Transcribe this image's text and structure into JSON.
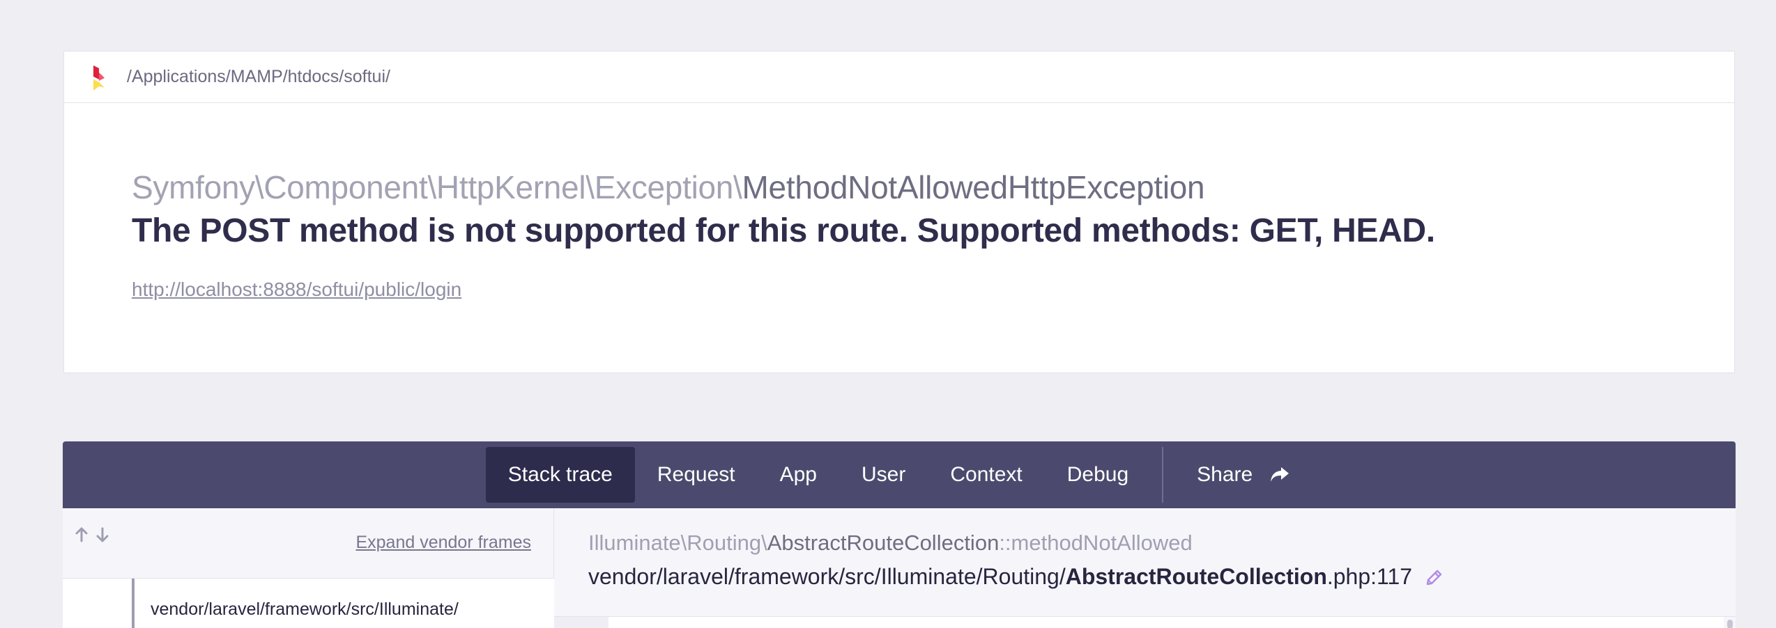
{
  "header": {
    "path": "/Applications/MAMP/htdocs/softui/"
  },
  "exception": {
    "namespace": "Symfony\\Component\\HttpKernel\\Exception\\",
    "class_name": "MethodNotAllowedHttpException",
    "message": "The POST method is not supported for this route. Supported methods: GET, HEAD.",
    "url": "http://localhost:8888/softui/public/login"
  },
  "tabs": {
    "stack_trace": "Stack trace",
    "request": "Request",
    "app": "App",
    "user": "User",
    "context": "Context",
    "debug": "Debug",
    "share": "Share",
    "active": "Stack trace"
  },
  "stack": {
    "expand_vendor": "Expand vendor frames",
    "frames": [
      {
        "path": "vendor/laravel/framework/src/Illuminate/"
      }
    ],
    "selected": {
      "namespace": "Illuminate\\Routing\\",
      "class": "AbstractRouteCollection",
      "method": "::methodNotAllowed",
      "file_dir": "vendor/laravel/framework/src/Illuminate/Routing/",
      "file_name": "AbstractRouteCollection",
      "file_suffix": ".php:117"
    }
  },
  "colors": {
    "background": "#eeeef3",
    "tabs_bar": "#4b4a6e",
    "tab_active": "#2e2c4d",
    "logo_red": "#e0213c",
    "logo_yellow": "#fbdd4f",
    "pencil": "#b18be8"
  },
  "icons": {
    "logo": "ignition-logo",
    "arrow_up": "arrow-up-icon",
    "arrow_down": "arrow-down-icon",
    "share": "share-arrow-icon",
    "edit": "pencil-icon"
  }
}
